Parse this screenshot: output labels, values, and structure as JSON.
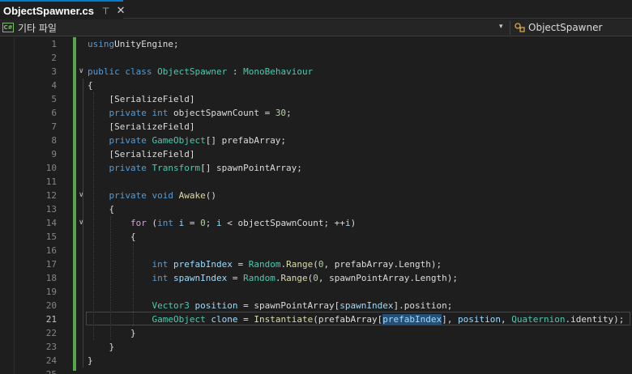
{
  "tab": {
    "title": "ObjectSpawner.cs",
    "pin_glyph": "⊣",
    "close_glyph": "✕"
  },
  "navbar": {
    "project_label": "기타 파일",
    "cs_icon_text": "C#",
    "dropdown_glyph": "▾",
    "member_label": "ObjectSpawner"
  },
  "editor": {
    "active_line": 21,
    "line_numbers": [
      "1",
      "2",
      "3",
      "4",
      "5",
      "6",
      "7",
      "8",
      "9",
      "10",
      "11",
      "12",
      "13",
      "14",
      "15",
      "16",
      "17",
      "18",
      "19",
      "20",
      "21",
      "22",
      "23",
      "24",
      "25"
    ],
    "fold_glyph": "∨",
    "fold_lines": [
      3,
      12,
      14
    ],
    "lines": [
      [
        [
          "kw",
          "using"
        ],
        [
          "",
          "UnityEngine;"
        ]
      ],
      [],
      [
        [
          "kw",
          "public"
        ],
        [
          "",
          " "
        ],
        [
          "kw",
          "class"
        ],
        [
          "",
          " "
        ],
        [
          "ty",
          "ObjectSpawner"
        ],
        [
          "",
          " : "
        ],
        [
          "ty",
          "MonoBehaviour"
        ]
      ],
      [
        [
          "",
          "{"
        ]
      ],
      [
        [
          "",
          "    [SerializeField]"
        ]
      ],
      [
        [
          "",
          "    "
        ],
        [
          "kw",
          "private"
        ],
        [
          "",
          " "
        ],
        [
          "kw",
          "int"
        ],
        [
          "",
          " objectSpawnCount = "
        ],
        [
          "nm",
          "30"
        ],
        [
          "",
          ";"
        ]
      ],
      [
        [
          "",
          "    [SerializeField]"
        ]
      ],
      [
        [
          "",
          "    "
        ],
        [
          "kw",
          "private"
        ],
        [
          "",
          " "
        ],
        [
          "ty",
          "GameObject"
        ],
        [
          "",
          "[] prefabArray;"
        ]
      ],
      [
        [
          "",
          "    [SerializeField]"
        ]
      ],
      [
        [
          "",
          "    "
        ],
        [
          "kw",
          "private"
        ],
        [
          "",
          " "
        ],
        [
          "ty",
          "Transform"
        ],
        [
          "",
          "[] spawnPointArray;"
        ]
      ],
      [],
      [
        [
          "",
          "    "
        ],
        [
          "kw",
          "private"
        ],
        [
          "",
          " "
        ],
        [
          "kw",
          "void"
        ],
        [
          "",
          " "
        ],
        [
          "fn",
          "Awake"
        ],
        [
          "",
          "()"
        ]
      ],
      [
        [
          "",
          "    {"
        ]
      ],
      [
        [
          "",
          "        "
        ],
        [
          "ctl",
          "for"
        ],
        [
          "",
          " ("
        ],
        [
          "kw",
          "int"
        ],
        [
          "",
          " "
        ],
        [
          "lv",
          "i"
        ],
        [
          "",
          " = "
        ],
        [
          "nm",
          "0"
        ],
        [
          "",
          "; "
        ],
        [
          "lv",
          "i"
        ],
        [
          "",
          " < objectSpawnCount; ++"
        ],
        [
          "lv",
          "i"
        ],
        [
          "",
          ")"
        ]
      ],
      [
        [
          "",
          "        {"
        ]
      ],
      [],
      [
        [
          "",
          "            "
        ],
        [
          "kw",
          "int"
        ],
        [
          "",
          " "
        ],
        [
          "lv",
          "prefabIndex"
        ],
        [
          "",
          " = "
        ],
        [
          "ty",
          "Random"
        ],
        [
          "",
          "."
        ],
        [
          "fn",
          "Range"
        ],
        [
          "",
          "("
        ],
        [
          "nm",
          "0"
        ],
        [
          "",
          ", prefabArray.Length);"
        ]
      ],
      [
        [
          "",
          "            "
        ],
        [
          "kw",
          "int"
        ],
        [
          "",
          " "
        ],
        [
          "lv",
          "spawnIndex"
        ],
        [
          "",
          " = "
        ],
        [
          "ty",
          "Random"
        ],
        [
          "",
          "."
        ],
        [
          "fn",
          "Range"
        ],
        [
          "",
          "("
        ],
        [
          "nm",
          "0"
        ],
        [
          "",
          ", spawnPointArray.Length);"
        ]
      ],
      [],
      [
        [
          "",
          "            "
        ],
        [
          "ty",
          "Vector3"
        ],
        [
          "",
          " "
        ],
        [
          "lv",
          "position"
        ],
        [
          "",
          " = spawnPointArray["
        ],
        [
          "lv",
          "spawnIndex"
        ],
        [
          "",
          "].position;"
        ]
      ],
      [
        [
          "",
          "            "
        ],
        [
          "ty",
          "GameObject"
        ],
        [
          "",
          " "
        ],
        [
          "lv",
          "clone"
        ],
        [
          "",
          " = "
        ],
        [
          "fn",
          "Instantiate"
        ],
        [
          "",
          "(prefabArray["
        ],
        [
          "lv ref",
          "prefabIndex"
        ],
        [
          "",
          "], "
        ],
        [
          "lv",
          "position"
        ],
        [
          "",
          ", "
        ],
        [
          "ty",
          "Quaternion"
        ],
        [
          "",
          ".identity);"
        ]
      ],
      [
        [
          "",
          "        }"
        ]
      ],
      [
        [
          "",
          "    }"
        ]
      ],
      [
        [
          "",
          "}"
        ]
      ],
      []
    ]
  }
}
